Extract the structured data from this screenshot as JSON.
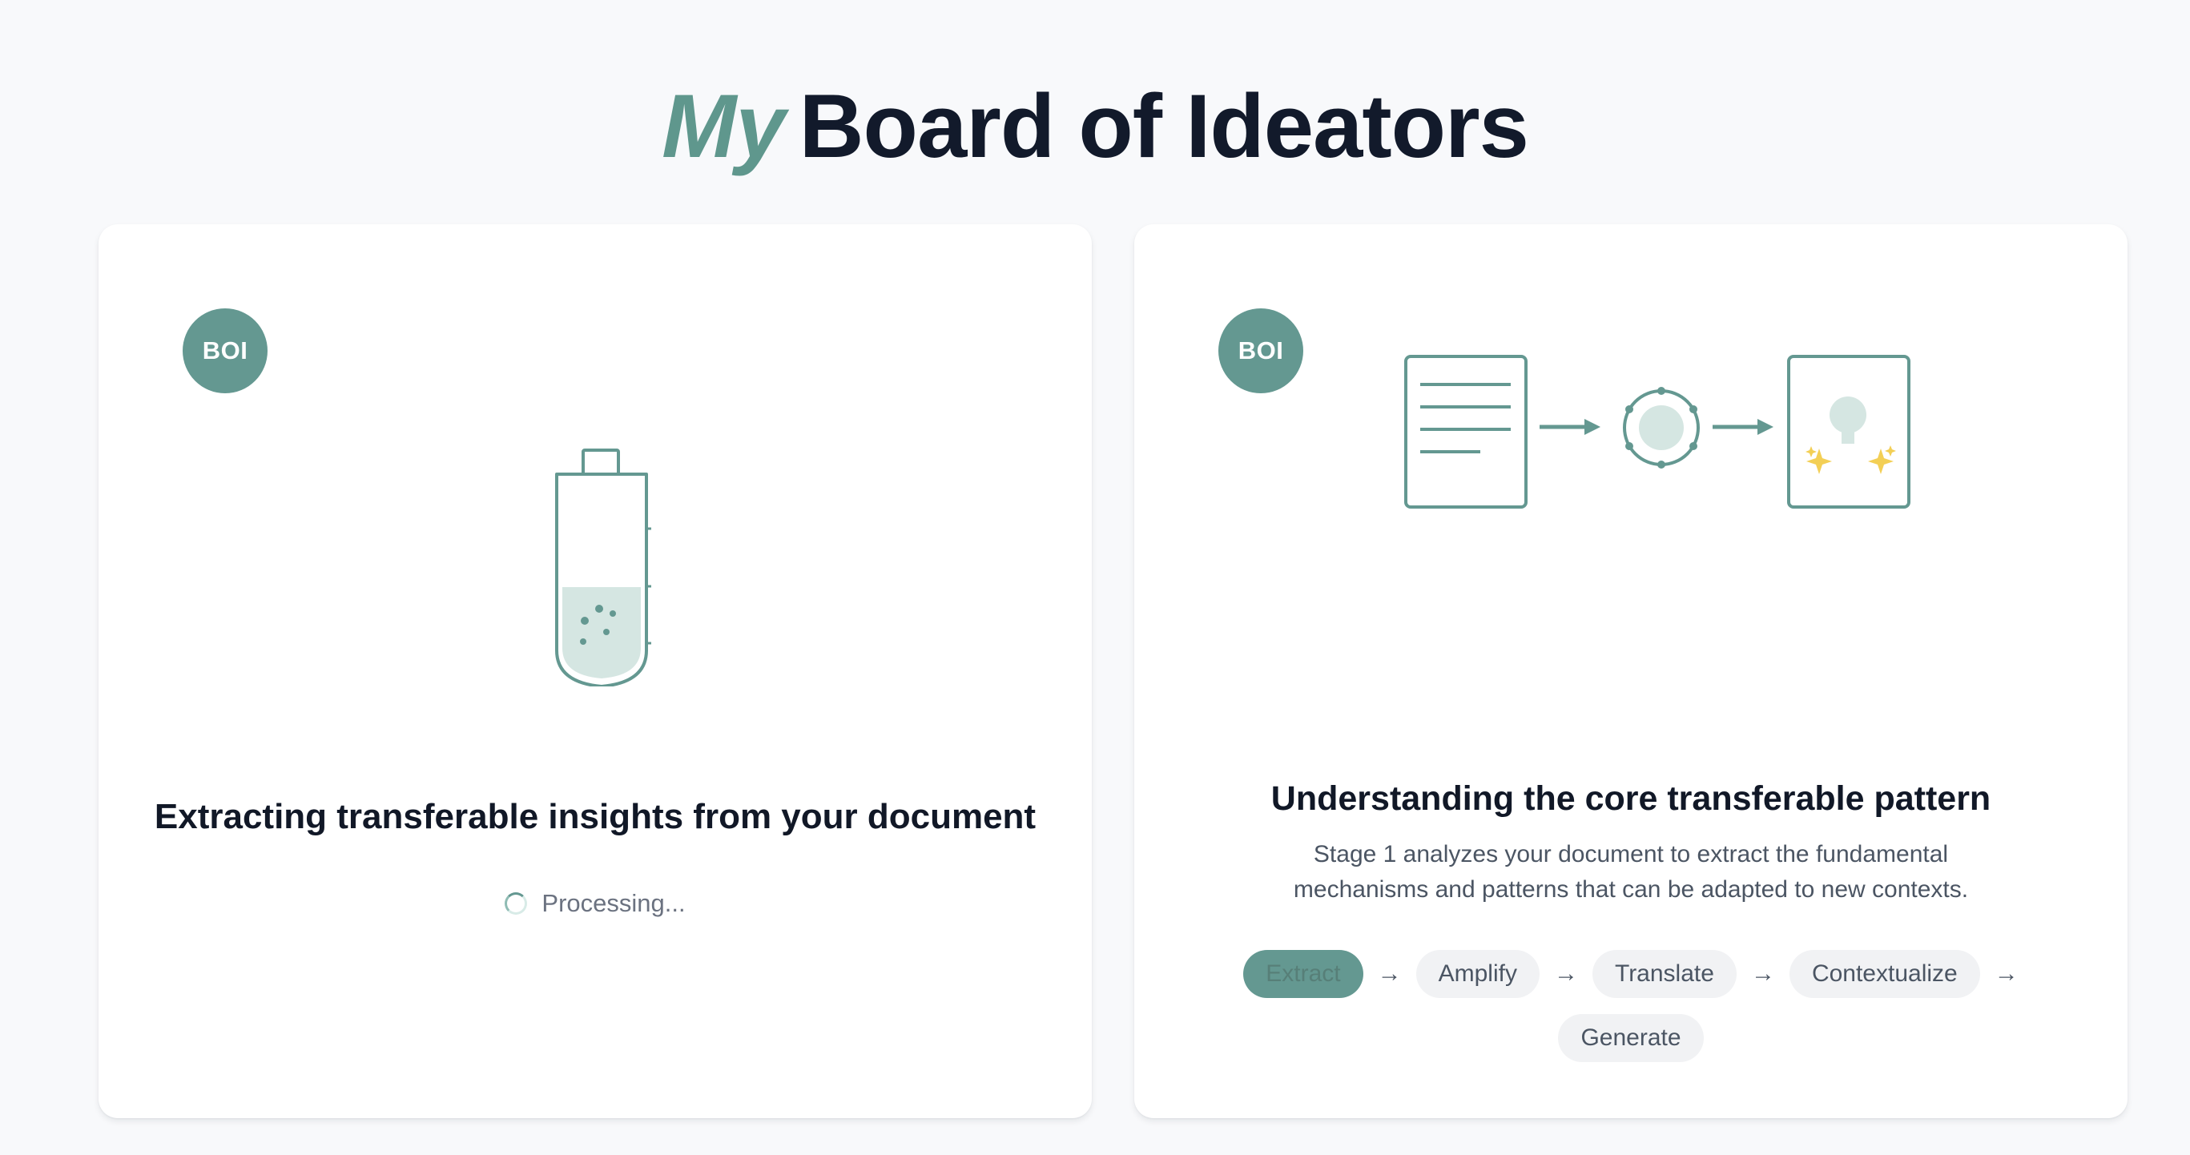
{
  "header": {
    "title_accent": "My",
    "title_rest": "Board of Ideators"
  },
  "left_card": {
    "avatar_label": "BOI",
    "heading": "Extracting transferable insights from your document",
    "status": "Processing..."
  },
  "right_card": {
    "avatar_label": "BOI",
    "heading": "Understanding the core transferable pattern",
    "description": "Stage 1 analyzes your document to extract the fundamental mechanisms and patterns that can be adapted to new contexts.",
    "steps": [
      {
        "label": "Extract",
        "active": true
      },
      {
        "label": "Amplify",
        "active": false
      },
      {
        "label": "Translate",
        "active": false
      },
      {
        "label": "Contextualize",
        "active": false
      },
      {
        "label": "Generate",
        "active": false
      }
    ],
    "step_separator": "→"
  },
  "colors": {
    "accent": "#649891",
    "title_accent": "#5f978d",
    "background": "#f8f9fb",
    "card": "#ffffff",
    "pill": "#f1f2f4"
  },
  "icons": [
    "test-tube-icon",
    "document-icon",
    "arrow-right-icon",
    "process-circle-icon",
    "lightbulb-sparkle-icon",
    "spinner-icon"
  ]
}
